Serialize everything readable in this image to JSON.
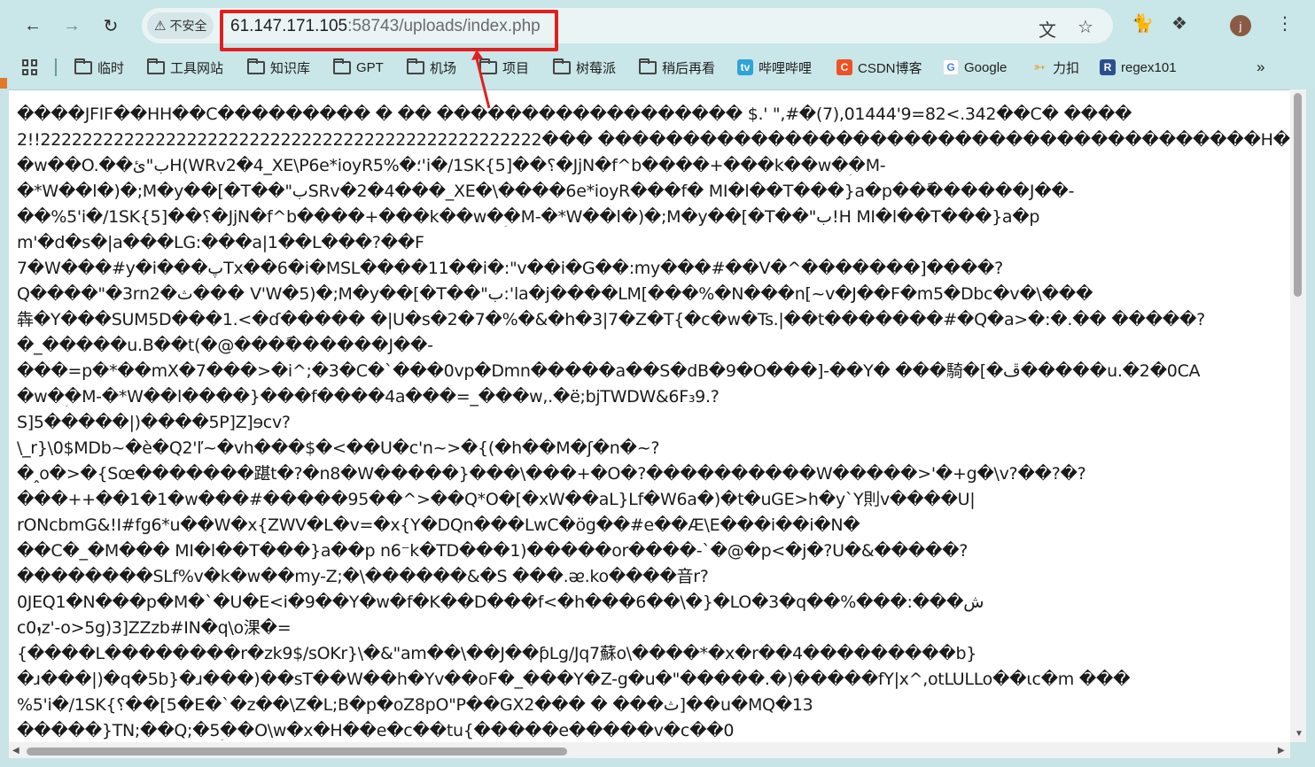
{
  "browser": {
    "security_label": "不安全",
    "url_host": "61.147.171.105",
    "url_port": ":58743",
    "url_path": "/uploads/index.php",
    "avatar_letter": "j"
  },
  "bookmarks": [
    {
      "label": "临时",
      "type": "folder"
    },
    {
      "label": "工具网站",
      "type": "folder"
    },
    {
      "label": "知识库",
      "type": "folder"
    },
    {
      "label": "GPT",
      "type": "folder"
    },
    {
      "label": "机场",
      "type": "folder"
    },
    {
      "label": "项目",
      "type": "folder"
    },
    {
      "label": "树莓派",
      "type": "folder"
    },
    {
      "label": "稍后再看",
      "type": "folder"
    },
    {
      "label": "哔哩哔哩",
      "type": "bilibili"
    },
    {
      "label": "CSDN博客",
      "type": "csdn"
    },
    {
      "label": "Google",
      "type": "google"
    },
    {
      "label": "力扣",
      "type": "leetcode"
    },
    {
      "label": "regex101",
      "type": "regex"
    }
  ],
  "colors": {
    "highlight": "#e0201f",
    "chrome_bg": "#c9e6e8"
  },
  "page_lines": [
    "����JFIF��HH��C��������� � �� ������������������ $.' \",#�(7),01444'9=82<.342��C� ����",
    "2!!222222222222222222222222222222222222222222222222��� ���������������������������������������H����",
    "�w��O.��ب\"ئH(WRv2�4_XE\\P6e*ioyR5%�؛'i�/1SK{؟��[5�JjN�f^b����+���k��w�ؚ�M-",
    "�*W��l�)�;M�y��[�T��\"بSRv�2�4���_XE�\\����6e*ioyR���f� MI�l��T���}a�p���ً�����J��-",
    "��%5'i�/1SK{؟��[5�JjN�f^b����+���k��w�ؚ�M-�*W��l�)�;M�y��[�T��\"ب!H MI�l��T���}a�p",
    "m'�d�s�|a���LG:���a|1��L���?��F",
    "7�W���#y�i���پTx��6�i�MSL����11��i�:\"v��i�G��:my���#��V�^�������]����?",
    "Q����\"�3rn2�ث���  V'W�5)�;M�y��[�T��\"ب:'la�j����LM[���%�N���n[~v�J��F�m5�Dbc�v�\\���",
    "犇�Y���SUM5D���1.<�ɗ����� �|U�s�2�7�%�&�h�3|7�Z�T{�c�w�Ts.|��t�������#�Q�a>�:�.�� �����?",
    "�_�����u.B��t(�@����ً�����J��-",
    "���=p�*��mX�7���>�i^;�3�C�`���0vp�Dmn�����a��S�dB�9�O���]-��Y� ���騎�[�ڦ�����u.�2�0CA",
    "�w�ؚ�M-�*W��l����}���f����4a���=_���w,.�ë;bjTWDW&6F₃9.?",
    "S]5�����|)����5P]Z]ɘcv?",
    "\\_r}\\0$MDb~�è�Q2'ľ~�vh���$�<��U�c'n~>�{(�h��M�ʃ�n�~?",
    "�ꞈo�>�{Sœ�������踸t�?�n8�W�����}���\\���+�O�?����������W�����>'�+g�\\v?��?�?",
    "���++��1�1�w���#�����95��^>��Q*O�[�xW��aL}Lf�W6a�)�t�uGE>h�y`Y則v����U|",
    "rONcbmG&!I#fg6*u��W�x{ZWV�L�v=�x{Y�DQn���LwC�ӧg��#e��Æ\\E���i��i�N�",
    "��C�_�M��� MI�l��T���}a��p n6⁻k�TD���1)�����or����-`�@�p<�j�?U�&�����?",
    "��������SLf%v�k�w��my-Z;�\\������&�S ���.ᴂ.ko����音r?",
    "0JEQ1�N���p�M�`�U�E<i�9��Y�w�f�K��D���f<�h���6��\\�}�LO�3�q��%���:���ش",
    "cܙ0z'-o>5g)3]ZZzb#IN�q\\o淉�=",
    "{����L��������r�zk9$/sOKr}\\�&\"am��\\��J��ƥLg/Jq7蘇o\\����*�x�r��4���������b}",
    "�ɹ���|)�q�5b}�ɹ���)��sT��W��h�Yv��oF�_���Y�Z-g�u�\"�����.�)�����fY|x^,otLULLo��ɩc�m ���",
    "%5'i�/1SK{؟��[5�E�`�z��\\Z�L;B�p�oZ8pO\"P��GX2��� � ���ث]��u�MQ�13",
    "�����}TN;��Q;�5ؚ��O\\w�x�H��e�c��tu{�����e�����v�c��0"
  ]
}
